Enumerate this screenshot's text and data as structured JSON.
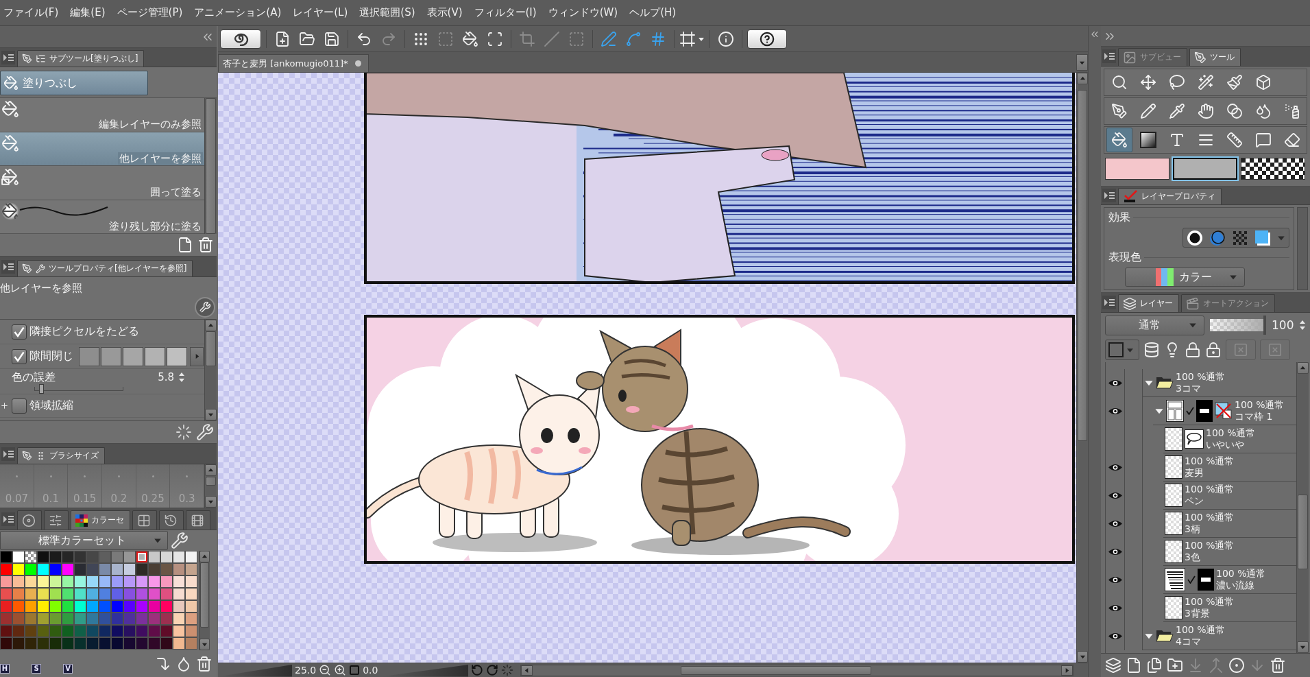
{
  "menu_bar": {
    "items": [
      "ファイル(F)",
      "編集(E)",
      "ページ管理(P)",
      "アニメーション(A)",
      "レイヤー(L)",
      "選択範囲(S)",
      "表示(V)",
      "フィルター(I)",
      "ウィンドウ(W)",
      "ヘルプ(H)"
    ]
  },
  "toolbar": {
    "groups": [
      [
        {
          "kind": "app",
          "disabled": false,
          "on": false
        }
      ],
      [
        {
          "kind": "new",
          "disabled": false,
          "on": false
        },
        {
          "kind": "open",
          "disabled": false,
          "on": false
        },
        {
          "kind": "save",
          "disabled": false,
          "on": false
        }
      ],
      [
        {
          "kind": "undo",
          "disabled": false,
          "on": false
        },
        {
          "kind": "redo",
          "disabled": true,
          "on": false
        }
      ],
      [
        {
          "kind": "select_all",
          "disabled": false,
          "on": false
        },
        {
          "kind": "deselect",
          "disabled": true,
          "on": false
        },
        {
          "kind": "fill_selection",
          "disabled": false,
          "on": false
        },
        {
          "kind": "transform",
          "disabled": false,
          "on": false
        }
      ],
      [
        {
          "kind": "crop",
          "disabled": true,
          "on": false
        },
        {
          "kind": "clear",
          "disabled": true,
          "on": false
        },
        {
          "kind": "border",
          "disabled": true,
          "on": false
        }
      ],
      [
        {
          "kind": "ruler_line",
          "disabled": false,
          "on": true
        },
        {
          "kind": "ruler_curve",
          "disabled": false,
          "on": true
        },
        {
          "kind": "ruler_grid",
          "disabled": false,
          "on": true
        }
      ],
      [
        {
          "kind": "frame_menu",
          "disabled": false,
          "on": false
        }
      ],
      [
        {
          "kind": "info",
          "disabled": false,
          "on": false
        }
      ],
      [
        {
          "kind": "help",
          "disabled": false,
          "on": false
        }
      ]
    ]
  },
  "subtool_panel": {
    "tab": "サブツール[塗りつぶし]",
    "group": "塗りつぶし",
    "items": [
      {
        "kind": "fill",
        "label": "編集レイヤーのみ参照",
        "selected": false
      },
      {
        "kind": "fill",
        "label": "他レイヤーを参照",
        "selected": true
      },
      {
        "kind": "enclose",
        "label": "囲って塗る",
        "selected": false
      },
      {
        "kind": "remaining",
        "label": "塗り残し部分に塗る",
        "selected": false
      }
    ]
  },
  "tool_property": {
    "tab": "ツールプロパティ[他レイヤーを参照]",
    "title": "他レイヤーを参照",
    "rows": [
      {
        "kind": "checkbox",
        "label": "隣接ピクセルをたどる",
        "checked": true
      },
      {
        "kind": "gap",
        "label": "隙間閉じ",
        "checked": true
      },
      {
        "kind": "slider",
        "label": "色の誤差",
        "level": 0.058,
        "reading": "5.8"
      },
      {
        "kind": "expand",
        "label": "領域拡縮",
        "checked": false
      }
    ]
  },
  "brush_size": {
    "tab": "ブラシサイズ",
    "sizes": [
      {
        "label": "0.07",
        "selected": false
      },
      {
        "label": "0.1",
        "selected": false
      },
      {
        "label": "0.15",
        "selected": false
      },
      {
        "label": "0.2",
        "selected": false
      },
      {
        "label": "0.25",
        "selected": false
      },
      {
        "label": "0.3",
        "selected": false
      }
    ]
  },
  "color_panel": {
    "tabs": [
      {
        "kind": "wheel",
        "selected": false
      },
      {
        "kind": "slider",
        "selected": false
      },
      {
        "kind": "set",
        "label": "カラーセ",
        "selected": true
      },
      {
        "kind": "approx",
        "selected": false
      },
      {
        "kind": "history",
        "selected": false
      },
      {
        "kind": "film",
        "selected": false
      }
    ],
    "preset": "標準カラーセット",
    "swatches": [
      {
        "kind": "color",
        "color": "#000000",
        "selected": false
      },
      {
        "kind": "color",
        "color": "#ffffff",
        "selected": false
      },
      {
        "kind": "transparent",
        "selected": false
      },
      {
        "kind": "color",
        "color": "#0f0f0f",
        "selected": false
      },
      {
        "kind": "color",
        "color": "#1b1b1b",
        "selected": false
      },
      {
        "kind": "color",
        "color": "#262626",
        "selected": false
      },
      {
        "kind": "color",
        "color": "#333333",
        "selected": false
      },
      {
        "kind": "color",
        "color": "#474747",
        "selected": false
      },
      {
        "kind": "color",
        "color": "#5e5e5e",
        "selected": false
      },
      {
        "kind": "color",
        "color": "#7a7a7a",
        "selected": false
      },
      {
        "kind": "color",
        "color": "#969696",
        "selected": false
      },
      {
        "kind": "color",
        "color": "#b0b0b0",
        "selected": true
      },
      {
        "kind": "color",
        "color": "#c8c8c8",
        "selected": false
      },
      {
        "kind": "color",
        "color": "#d8d8d8",
        "selected": false
      },
      {
        "kind": "color",
        "color": "#e6e6e6",
        "selected": false
      },
      {
        "kind": "color",
        "color": "#f2f2f2",
        "selected": false
      },
      {
        "kind": "color",
        "color": "#ff0000",
        "selected": false
      },
      {
        "kind": "color",
        "color": "#ffff00",
        "selected": false
      },
      {
        "kind": "color",
        "color": "#00ff00",
        "selected": false
      },
      {
        "kind": "color",
        "color": "#00ffff",
        "selected": false
      },
      {
        "kind": "color",
        "color": "#0000ff",
        "selected": false
      },
      {
        "kind": "color",
        "color": "#ff00ff",
        "selected": false
      },
      {
        "kind": "color",
        "color": "#2a2c33",
        "selected": false
      },
      {
        "kind": "color",
        "color": "#414656",
        "selected": false
      },
      {
        "kind": "color",
        "color": "#7a8aa8",
        "selected": false
      },
      {
        "kind": "color",
        "color": "#a8b4cc",
        "selected": false
      },
      {
        "kind": "color",
        "color": "#c6cde0",
        "selected": false
      },
      {
        "kind": "color",
        "color": "#2e2a26",
        "selected": false
      },
      {
        "kind": "color",
        "color": "#4a3e34",
        "selected": false
      },
      {
        "kind": "color",
        "color": "#6a5646",
        "selected": false
      },
      {
        "kind": "color",
        "color": "#b69080",
        "selected": false
      },
      {
        "kind": "color",
        "color": "#c4a48e",
        "selected": false
      },
      {
        "kind": "color",
        "color": "#f79a9a",
        "selected": false
      },
      {
        "kind": "color",
        "color": "#f8bc96",
        "selected": false
      },
      {
        "kind": "color",
        "color": "#fbd898",
        "selected": false
      },
      {
        "kind": "color",
        "color": "#fbf597",
        "selected": false
      },
      {
        "kind": "color",
        "color": "#ccf599",
        "selected": false
      },
      {
        "kind": "color",
        "color": "#97f5a4",
        "selected": false
      },
      {
        "kind": "color",
        "color": "#97f5e0",
        "selected": false
      },
      {
        "kind": "color",
        "color": "#97d8f8",
        "selected": false
      },
      {
        "kind": "color",
        "color": "#98b9f8",
        "selected": false
      },
      {
        "kind": "color",
        "color": "#9b9bf8",
        "selected": false
      },
      {
        "kind": "color",
        "color": "#b797f8",
        "selected": false
      },
      {
        "kind": "color",
        "color": "#d798f8",
        "selected": false
      },
      {
        "kind": "color",
        "color": "#f898e8",
        "selected": false
      },
      {
        "kind": "color",
        "color": "#f898bc",
        "selected": false
      },
      {
        "kind": "color",
        "color": "#f8e0d8",
        "selected": false
      },
      {
        "kind": "color",
        "color": "#f8dccc",
        "selected": false
      },
      {
        "kind": "color",
        "color": "#e84f4f",
        "selected": false
      },
      {
        "kind": "color",
        "color": "#e88048",
        "selected": false
      },
      {
        "kind": "color",
        "color": "#e8b050",
        "selected": false
      },
      {
        "kind": "color",
        "color": "#e8e050",
        "selected": false
      },
      {
        "kind": "color",
        "color": "#a0e050",
        "selected": false
      },
      {
        "kind": "color",
        "color": "#50e070",
        "selected": false
      },
      {
        "kind": "color",
        "color": "#50e0c8",
        "selected": false
      },
      {
        "kind": "color",
        "color": "#50b0e0",
        "selected": false
      },
      {
        "kind": "color",
        "color": "#5080e0",
        "selected": false
      },
      {
        "kind": "color",
        "color": "#6060e8",
        "selected": false
      },
      {
        "kind": "color",
        "color": "#8850e0",
        "selected": false
      },
      {
        "kind": "color",
        "color": "#b050e0",
        "selected": false
      },
      {
        "kind": "color",
        "color": "#e050c8",
        "selected": false
      },
      {
        "kind": "color",
        "color": "#e05080",
        "selected": false
      },
      {
        "kind": "color",
        "color": "#f5dcd0",
        "selected": false
      },
      {
        "kind": "color",
        "color": "#f8d8c0",
        "selected": false
      },
      {
        "kind": "color",
        "color": "#e82020",
        "selected": false
      },
      {
        "kind": "color",
        "color": "#ff5a00",
        "selected": false
      },
      {
        "kind": "color",
        "color": "#ffa000",
        "selected": false
      },
      {
        "kind": "color",
        "color": "#ffee00",
        "selected": false
      },
      {
        "kind": "color",
        "color": "#80ff00",
        "selected": false
      },
      {
        "kind": "color",
        "color": "#20e040",
        "selected": false
      },
      {
        "kind": "color",
        "color": "#00ffd0",
        "selected": false
      },
      {
        "kind": "color",
        "color": "#00a8ff",
        "selected": false
      },
      {
        "kind": "color",
        "color": "#0050ff",
        "selected": false
      },
      {
        "kind": "color",
        "color": "#0000ff",
        "selected": false
      },
      {
        "kind": "color",
        "color": "#5800ff",
        "selected": false
      },
      {
        "kind": "color",
        "color": "#a800ff",
        "selected": false
      },
      {
        "kind": "color",
        "color": "#e800a0",
        "selected": false
      },
      {
        "kind": "color",
        "color": "#ff0060",
        "selected": false
      },
      {
        "kind": "color",
        "color": "#e8c8bc",
        "selected": false
      },
      {
        "kind": "color",
        "color": "#f0c8a8",
        "selected": false
      },
      {
        "kind": "color",
        "color": "#9c3030",
        "selected": false
      },
      {
        "kind": "color",
        "color": "#9c5030",
        "selected": false
      },
      {
        "kind": "color",
        "color": "#9c7830",
        "selected": false
      },
      {
        "kind": "color",
        "color": "#a0a030",
        "selected": false
      },
      {
        "kind": "color",
        "color": "#6a9c30",
        "selected": false
      },
      {
        "kind": "color",
        "color": "#309c40",
        "selected": false
      },
      {
        "kind": "color",
        "color": "#309c88",
        "selected": false
      },
      {
        "kind": "color",
        "color": "#30789c",
        "selected": false
      },
      {
        "kind": "color",
        "color": "#30509c",
        "selected": false
      },
      {
        "kind": "color",
        "color": "#30309c",
        "selected": false
      },
      {
        "kind": "color",
        "color": "#50309c",
        "selected": false
      },
      {
        "kind": "color",
        "color": "#7c309c",
        "selected": false
      },
      {
        "kind": "color",
        "color": "#9c307c",
        "selected": false
      },
      {
        "kind": "color",
        "color": "#9c3050",
        "selected": false
      },
      {
        "kind": "color",
        "color": "#f8d4b4",
        "selected": false
      },
      {
        "kind": "color",
        "color": "#dca080",
        "selected": false
      },
      {
        "kind": "color",
        "color": "#601010",
        "selected": false
      },
      {
        "kind": "color",
        "color": "#602810",
        "selected": false
      },
      {
        "kind": "color",
        "color": "#604010",
        "selected": false
      },
      {
        "kind": "color",
        "color": "#586010",
        "selected": false
      },
      {
        "kind": "color",
        "color": "#305c10",
        "selected": false
      },
      {
        "kind": "color",
        "color": "#106020",
        "selected": false
      },
      {
        "kind": "color",
        "color": "#106048",
        "selected": false
      },
      {
        "kind": "color",
        "color": "#104860",
        "selected": false
      },
      {
        "kind": "color",
        "color": "#102860",
        "selected": false
      },
      {
        "kind": "color",
        "color": "#100c60",
        "selected": false
      },
      {
        "kind": "color",
        "color": "#281060",
        "selected": false
      },
      {
        "kind": "color",
        "color": "#400c60",
        "selected": false
      },
      {
        "kind": "color",
        "color": "#600c48",
        "selected": false
      },
      {
        "kind": "color",
        "color": "#600c28",
        "selected": false
      },
      {
        "kind": "color",
        "color": "#f8c4a0",
        "selected": false
      },
      {
        "kind": "color",
        "color": "#cc9070",
        "selected": false
      },
      {
        "kind": "color",
        "color": "#300808",
        "selected": false
      },
      {
        "kind": "color",
        "color": "#2c1808",
        "selected": false
      },
      {
        "kind": "color",
        "color": "#302408",
        "selected": false
      },
      {
        "kind": "color",
        "color": "#2c3008",
        "selected": false
      },
      {
        "kind": "color",
        "color": "#182c08",
        "selected": false
      },
      {
        "kind": "color",
        "color": "#083018",
        "selected": false
      },
      {
        "kind": "color",
        "color": "#08302c",
        "selected": false
      },
      {
        "kind": "color",
        "color": "#081c30",
        "selected": false
      },
      {
        "kind": "color",
        "color": "#081030",
        "selected": false
      },
      {
        "kind": "color",
        "color": "#080830",
        "selected": false
      },
      {
        "kind": "color",
        "color": "#180830",
        "selected": false
      },
      {
        "kind": "color",
        "color": "#240830",
        "selected": false
      },
      {
        "kind": "color",
        "color": "#300828",
        "selected": false
      },
      {
        "kind": "color",
        "color": "#300818",
        "selected": false
      },
      {
        "kind": "color",
        "color": "#f0b890",
        "selected": false
      },
      {
        "kind": "color",
        "color": "#b48060",
        "selected": false
      }
    ],
    "modes": [
      "H",
      "S",
      "V"
    ]
  },
  "canvas": {
    "tab": "杏子と麦男 [ankomugio011]*"
  },
  "status_bar": {
    "zoom": "25.0",
    "rotation": "0.0"
  },
  "tool_panel": {
    "tabs": [
      {
        "label": "サブビュー",
        "selected": false
      },
      {
        "label": "ツール",
        "selected": true
      }
    ],
    "tool_rows": [
      {
        "tools": [
          {
            "kind": "zoom",
            "selected": false
          },
          {
            "kind": "move",
            "selected": false
          },
          {
            "kind": "lasso",
            "selected": false
          },
          {
            "kind": "auto_select",
            "selected": false
          },
          {
            "kind": "correct",
            "selected": false
          },
          {
            "kind": "object",
            "selected": false
          }
        ]
      },
      {
        "tools": [
          {
            "kind": "pen",
            "selected": false
          },
          {
            "kind": "pencil",
            "selected": false
          },
          {
            "kind": "brush",
            "selected": false
          },
          {
            "kind": "hand",
            "selected": false
          },
          {
            "kind": "blend",
            "selected": false
          },
          {
            "kind": "droplet",
            "selected": false
          },
          {
            "kind": "airbrush",
            "selected": false
          }
        ]
      },
      {
        "tools": [
          {
            "kind": "fill",
            "selected": true
          },
          {
            "kind": "gradient",
            "selected": false
          },
          {
            "kind": "text",
            "selected": false
          },
          {
            "kind": "tone",
            "selected": false
          },
          {
            "kind": "ruler",
            "selected": false
          },
          {
            "kind": "balloon",
            "selected": false
          },
          {
            "kind": "eraser",
            "selected": false
          }
        ]
      }
    ],
    "colors": [
      {
        "kind": "main",
        "color": "#f4c6cb",
        "selected": false
      },
      {
        "kind": "sub",
        "color": "#b0b0b0",
        "selected": true
      },
      {
        "kind": "transparent",
        "selected": false
      }
    ]
  },
  "layer_property": {
    "tab": "レイヤープロパティ",
    "effect_label": "効果",
    "color_label": "表現色",
    "color_mode": "カラー"
  },
  "layer_panel": {
    "tabs": [
      {
        "label": "レイヤー",
        "selected": true
      },
      {
        "label": "オートアクション",
        "selected": false
      }
    ],
    "blend_mode": "通常",
    "opacity": {
      "level": 1,
      "reading": "100"
    },
    "tools": [
      {
        "kind": "color",
        "disabled": false
      },
      {
        "kind": "reference",
        "disabled": false
      },
      {
        "kind": "draft",
        "disabled": false
      },
      {
        "kind": "lock",
        "disabled": false
      },
      {
        "kind": "lock_alpha",
        "disabled": false
      },
      {
        "kind": "mask",
        "disabled": true
      },
      {
        "kind": "ruler",
        "disabled": true
      }
    ],
    "layers": [
      {
        "kind": "folder",
        "opacity_blend": "100 %通常",
        "name": "3コマ",
        "visible": true,
        "expanded": true,
        "children": [
          {
            "kind": "frame",
            "opacity_blend": "100 %通常",
            "name": "コマ枠 1",
            "visible": true,
            "expanded": true,
            "children": [
              {
                "kind": "balloon",
                "opacity_blend": "100 %通常",
                "name": "いやいや",
                "visible": false
              },
              {
                "kind": "raster",
                "opacity_blend": "100 %通常",
                "name": "麦男",
                "visible": true
              },
              {
                "kind": "raster",
                "opacity_blend": "100 %通常",
                "name": "ペン",
                "visible": true
              },
              {
                "kind": "raster",
                "opacity_blend": "100 %通常",
                "name": "3柄",
                "visible": true
              },
              {
                "kind": "raster",
                "opacity_blend": "100 %通常",
                "name": "3色",
                "visible": true
              },
              {
                "kind": "tone",
                "opacity_blend": "100 %通常",
                "name": "濃い流線",
                "visible": true
              },
              {
                "kind": "raster",
                "opacity_blend": "100 %通常",
                "name": "3背景",
                "visible": true
              }
            ]
          }
        ]
      },
      {
        "kind": "folder",
        "opacity_blend": "100 %通常",
        "name": "4コマ",
        "visible": true,
        "expanded": true
      }
    ],
    "buttons": [
      {
        "kind": "layers",
        "disabled": false
      },
      {
        "kind": "raster",
        "disabled": false
      },
      {
        "kind": "vector",
        "disabled": false
      },
      {
        "kind": "folder",
        "disabled": false
      },
      {
        "kind": "transfer",
        "disabled": true
      },
      {
        "kind": "merge",
        "disabled": true
      },
      {
        "kind": "mask",
        "disabled": false
      },
      {
        "kind": "apply_mask",
        "disabled": true
      },
      {
        "kind": "delete",
        "disabled": false
      }
    ]
  }
}
